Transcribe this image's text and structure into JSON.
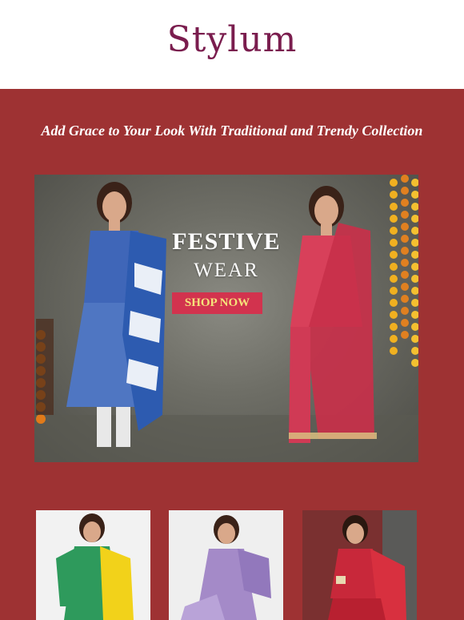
{
  "brand": {
    "logo_text": "Stylum",
    "color": "#7a1d4e"
  },
  "hero": {
    "tagline": "Add Grace to Your Look With Traditional and Trendy Collection",
    "background": "#9e3233"
  },
  "banner": {
    "title_line1": "FESTIVE",
    "title_line2": "WEAR",
    "cta_label": "SHOP NOW",
    "cta_color": "#d2334e",
    "cta_text_color": "#f5e27a"
  },
  "products": [
    {
      "name": "green-yellow-suit",
      "colors": [
        "#2e9a5c",
        "#f2d21a"
      ]
    },
    {
      "name": "lavender-suit",
      "colors": [
        "#a48ac8"
      ]
    },
    {
      "name": "red-sharara-suit",
      "colors": [
        "#c8283a"
      ]
    }
  ]
}
